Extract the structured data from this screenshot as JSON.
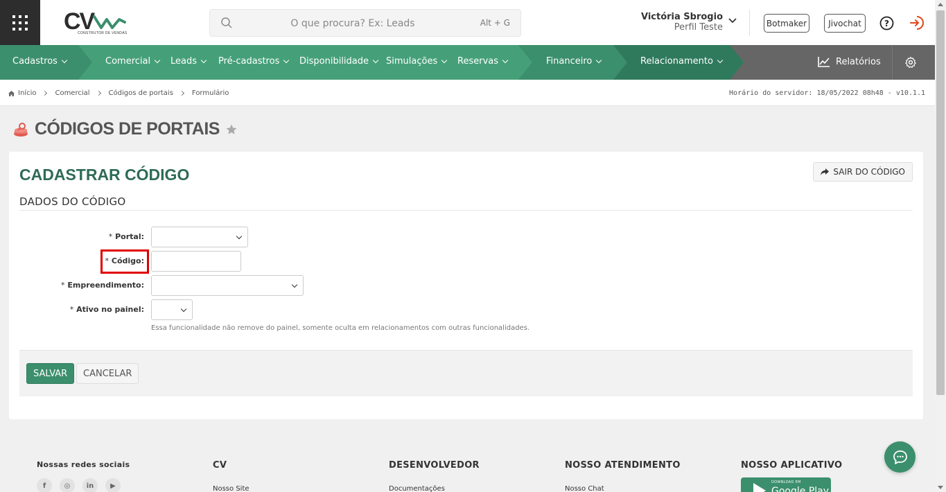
{
  "header": {
    "logo_text": "CV",
    "logo_subtitle": "CONSTRUTOR DE VENDAS",
    "search_placeholder": "O que procura? Ex: Leads",
    "search_shortcut": "Alt + G",
    "user_name": "Victória Sbrogio",
    "user_profile": "Perfil Teste",
    "botmaker_label": "Botmaker",
    "jivochat_label": "Jivochat"
  },
  "nav": {
    "items": [
      "Cadastros",
      "Comercial",
      "Leads",
      "Pré-cadastros",
      "Disponibilidade",
      "Simulações",
      "Reservas",
      "Financeiro",
      "Relacionamento"
    ],
    "reports_label": "Relatórios",
    "colors": {
      "dark": "#2f7a5c",
      "mid": "#3b8f6d",
      "light": "#45a079",
      "gray": "#666666"
    }
  },
  "breadcrumb": {
    "items": [
      "Início",
      "Comercial",
      "Códigos de portais",
      "Formulário"
    ],
    "server_time": "Horário do servidor: 18/05/2022 08h48 - v10.1.1"
  },
  "page": {
    "title": "CÓDIGOS DE PORTAIS"
  },
  "form": {
    "title": "CADASTRAR CÓDIGO",
    "exit_label": "SAIR DO CÓDIGO",
    "section": "DADOS DO CÓDIGO",
    "fields": {
      "portal": "Portal:",
      "codigo": "Código:",
      "empreendimento": "Empreendimento:",
      "ativo": "Ativo no painel:"
    },
    "required_mark": "*",
    "hint": "Essa funcionalidade não remove do painel, somente oculta em relacionamentos com outras funcionalidades.",
    "save_label": "SALVAR",
    "cancel_label": "CANCELAR"
  },
  "footer": {
    "social_title": "Nossas redes sociais",
    "social_icons": [
      "f",
      "◎",
      "in",
      "▶"
    ],
    "cv_title": "CV",
    "cv_link": "Nosso Site",
    "dev_title": "DESENVOLVEDOR",
    "dev_link": "Documentações",
    "support_title": "NOSSO ATENDIMENTO",
    "support_link": "Nosso Chat",
    "app_title": "NOSSO APLICATIVO",
    "gplay_small": "DOWNLOAD EM",
    "gplay_big": "Google Play"
  }
}
